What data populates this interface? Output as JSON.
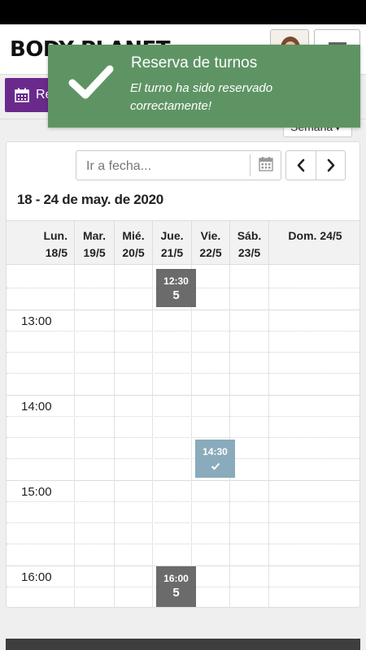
{
  "header": {
    "logo_text": "BODY PLANET",
    "menu_icon": "hamburger-icon",
    "avatar_icon": "user-avatar"
  },
  "action_button": {
    "label": "Re",
    "icon": "calendar-icon",
    "color": "#6a2a8c"
  },
  "view_select": {
    "value": "Semana"
  },
  "toolbar": {
    "goto_placeholder": "Ir a fecha...",
    "calendar_icon": "calendar-icon",
    "prev_icon": "chevron-left-icon",
    "next_icon": "chevron-right-icon"
  },
  "calendar": {
    "range_title": "18 - 24 de may. de 2020",
    "days": [
      {
        "name": "Lun.",
        "date": "18/5"
      },
      {
        "name": "Mar.",
        "date": "19/5"
      },
      {
        "name": "Mié.",
        "date": "20/5"
      },
      {
        "name": "Jue.",
        "date": "21/5"
      },
      {
        "name": "Vie.",
        "date": "22/5"
      },
      {
        "name": "Sáb.",
        "date": "23/5"
      },
      {
        "name": "Dom.",
        "date": "24/5"
      }
    ],
    "time_labels": [
      "13:00",
      "14:00",
      "15:00",
      "16:00"
    ],
    "events": [
      {
        "day": "Jue.",
        "time": "12:30",
        "count": "5",
        "status": "available",
        "color": "#6b6b6b"
      },
      {
        "day": "Vie.",
        "time": "14:30",
        "status": "reserved",
        "icon": "checkmark-icon",
        "color": "#8aabbb"
      },
      {
        "day": "Jue.",
        "time": "16:00",
        "count": "5",
        "status": "available",
        "color": "#6b6b6b"
      }
    ]
  },
  "toast": {
    "title": "Reserva de turnos",
    "message": "El turno ha sido reservado correctamente!",
    "icon": "checkmark-icon",
    "color": "#5e9464"
  }
}
